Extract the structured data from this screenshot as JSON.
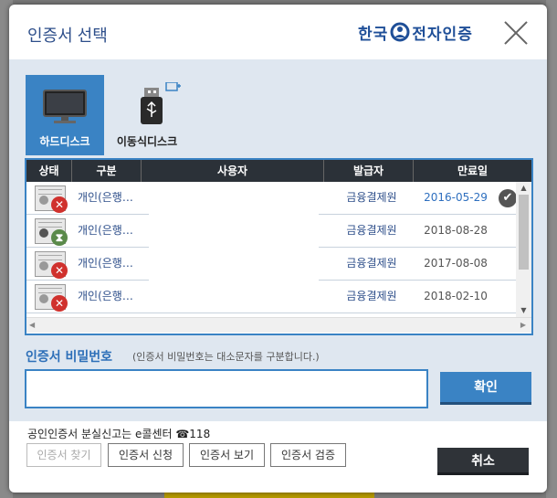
{
  "dialog": {
    "title": "인증서 선택",
    "brand": "한국 전자인증",
    "brand_left": "한국",
    "brand_right": "전자인증"
  },
  "media_tabs": [
    {
      "label": "하드디스크",
      "icon": "monitor-icon",
      "active": true
    },
    {
      "label": "이동식디스크",
      "icon": "usb-drive-icon",
      "active": false
    }
  ],
  "table": {
    "headers": [
      "상태",
      "구분",
      "사용자",
      "발급자",
      "만료일"
    ],
    "rows": [
      {
        "status": "expired",
        "type": "개인(은행…",
        "issuer": "금융결제원",
        "expiry": "2016-05-29",
        "selected": true
      },
      {
        "status": "pending",
        "type": "개인(은행…",
        "issuer": "금융결제원",
        "expiry": "2018-08-28",
        "selected": false
      },
      {
        "status": "expired",
        "type": "개인(은행…",
        "issuer": "금융결제원",
        "expiry": "2017-08-08",
        "selected": false
      },
      {
        "status": "expired",
        "type": "개인(은행…",
        "issuer": "금융결제원",
        "expiry": "2018-02-10",
        "selected": false
      }
    ]
  },
  "password": {
    "label": "인증서 비밀번호",
    "hint": "(인증서 비밀번호는 대소문자를 구분합니다.)",
    "value": "",
    "confirm_label": "확인"
  },
  "footer": {
    "lost_note": "공인인증서 분실신고는 e콜센터 ☎118",
    "buttons": [
      "인증서 찾기",
      "인증서 신청",
      "인증서 보기",
      "인증서 검증"
    ],
    "cancel_label": "취소"
  },
  "colors": {
    "accent": "#3a83c4",
    "header_dark": "#2b3138",
    "expired": "#d0312d"
  }
}
